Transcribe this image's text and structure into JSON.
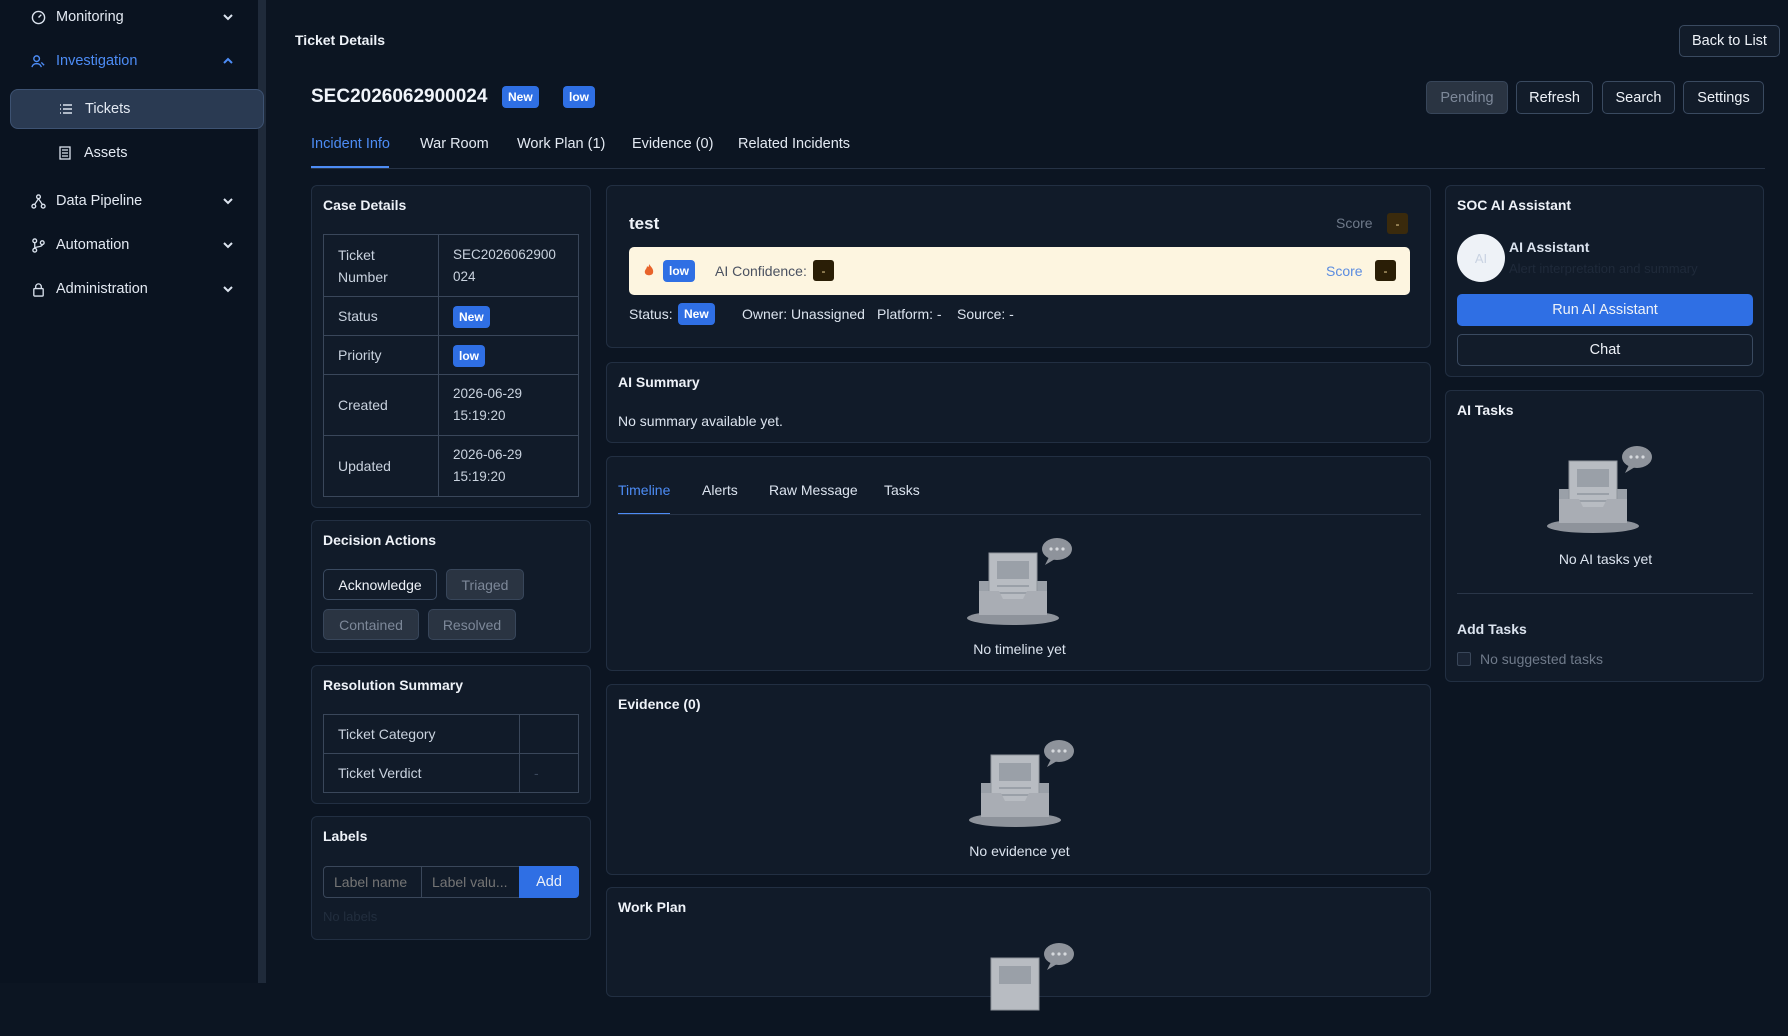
{
  "sidebar": {
    "items": [
      {
        "label": "Monitoring",
        "icon": "gauge-icon"
      },
      {
        "label": "Investigation",
        "icon": "investigation-icon"
      },
      {
        "label": "Tickets",
        "icon": "list-icon"
      },
      {
        "label": "Assets",
        "icon": "document-icon"
      },
      {
        "label": "Data Pipeline",
        "icon": "pipeline-icon"
      },
      {
        "label": "Automation",
        "icon": "branch-icon"
      },
      {
        "label": "Administration",
        "icon": "lock-icon"
      }
    ]
  },
  "header": {
    "title": "Ticket Details",
    "back_label": "Back to List",
    "ticket_id": "SEC2026062900024",
    "status_badge": "New",
    "priority_badge": "low",
    "actions": {
      "pending": "Pending",
      "refresh": "Refresh",
      "search": "Search",
      "settings": "Settings"
    }
  },
  "tabs": [
    "Incident Info",
    "War Room",
    "Work Plan (1)",
    "Evidence (0)",
    "Related Incidents"
  ],
  "case_details": {
    "title": "Case Details",
    "rows": [
      {
        "label": "Ticket Number",
        "value": "SEC2026062900024"
      },
      {
        "label": "Status",
        "value": "New"
      },
      {
        "label": "Priority",
        "value": "low"
      },
      {
        "label": "Created",
        "value": "2026-06-29 15:19:20"
      },
      {
        "label": "Updated",
        "value": "2026-06-29 15:19:20"
      }
    ]
  },
  "decision": {
    "title": "Decision Actions",
    "buttons": [
      "Acknowledge",
      "Triaged",
      "Contained",
      "Resolved"
    ]
  },
  "resolution": {
    "title": "Resolution Summary",
    "rows": [
      {
        "label": "Ticket Category",
        "value": ""
      },
      {
        "label": "Ticket Verdict",
        "value": "-"
      }
    ]
  },
  "labels": {
    "title": "Labels",
    "name_placeholder": "Label name",
    "value_placeholder": "Label valu...",
    "add_label": "Add",
    "empty": "No labels"
  },
  "incident": {
    "name": "test",
    "score_label": "Score",
    "score_value": "-",
    "severity": "low",
    "confidence_label": "AI Confidence:",
    "confidence_value": "-",
    "status_label": "Status:",
    "status_value": "New",
    "owner": "Owner: Unassigned",
    "platform": "Platform: -",
    "source": "Source: -"
  },
  "ai_summary": {
    "title": "AI Summary",
    "text": "No summary available yet."
  },
  "inner_tabs": [
    "Timeline",
    "Alerts",
    "Raw Message",
    "Tasks"
  ],
  "timeline_empty": "No timeline yet",
  "evidence": {
    "title": "Evidence (0)",
    "empty": "No evidence yet"
  },
  "work_plan": {
    "title": "Work Plan"
  },
  "assistant": {
    "title": "SOC AI Assistant",
    "avatar": "AI",
    "name": "AI Assistant",
    "subtitle": "Alert interpretation and summary",
    "run_label": "Run AI Assistant",
    "chat_label": "Chat"
  },
  "ai_tasks": {
    "title": "AI Tasks",
    "empty": "No AI tasks yet",
    "add_title": "Add Tasks",
    "no_suggested": "No suggested tasks"
  },
  "colors": {
    "accent": "#2f6fe4",
    "link": "#4d8cf5",
    "panel": "#111b29",
    "background": "#0c1522",
    "highlight": "#fdf5e0"
  }
}
